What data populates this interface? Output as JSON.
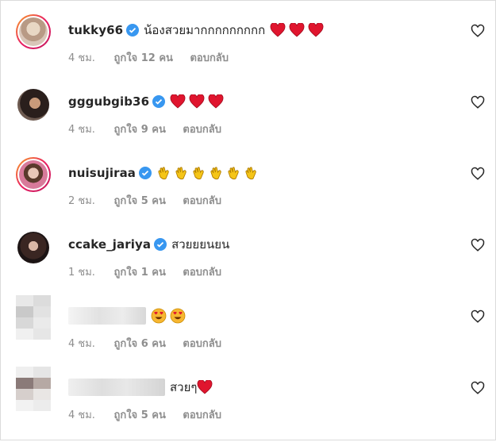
{
  "reply_label": "ตอบกลับ",
  "comments": [
    {
      "username": "tukky66",
      "verified": true,
      "text": "น้องสวยมากกกกกกกกก",
      "emojis": [
        "red-heart",
        "red-heart",
        "red-heart"
      ],
      "time": "4 ชม.",
      "likes": "ถูกใจ 12 คน"
    },
    {
      "username": "gggubgib36",
      "verified": true,
      "text": "",
      "emojis": [
        "red-heart",
        "red-heart",
        "red-heart"
      ],
      "time": "4 ชม.",
      "likes": "ถูกใจ 9 คน"
    },
    {
      "username": "nuisujiraa",
      "verified": true,
      "text": "",
      "emojis": [
        "clapping-hands",
        "clapping-hands",
        "clapping-hands",
        "clapping-hands",
        "clapping-hands",
        "clapping-hands"
      ],
      "time": "2 ชม.",
      "likes": "ถูกใจ 5 คน"
    },
    {
      "username": "ccake_jariya",
      "verified": true,
      "text": "สวยยยนยน",
      "emojis": [],
      "time": "1 ชม.",
      "likes": "ถูกใจ 1 คน"
    },
    {
      "username": "",
      "verified": false,
      "text": "",
      "emojis": [
        "heart-eyes-face",
        "heart-eyes-face"
      ],
      "time": "4 ชม.",
      "likes": "ถูกใจ 6 คน"
    },
    {
      "username": "",
      "verified": false,
      "text": "สวยๆ",
      "emojis": [
        "red-heart"
      ],
      "time": "4 ชม.",
      "likes": "ถูกใจ 5 คน"
    }
  ],
  "colors": {
    "verified": "#3897f0",
    "muted": "#8e8e8e",
    "heart": "#e0152e"
  }
}
